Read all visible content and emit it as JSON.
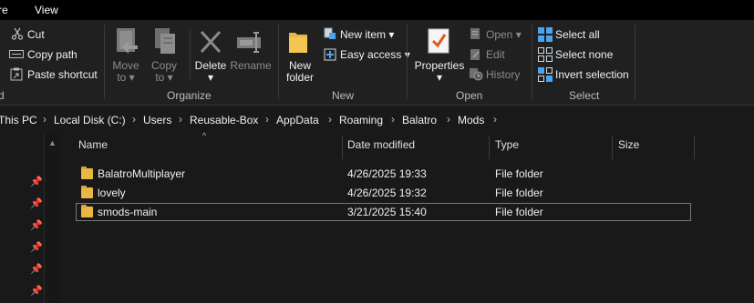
{
  "menubar": {
    "tabs": [
      "re",
      "View"
    ]
  },
  "ribbon": {
    "clipboard": {
      "cut": "Cut",
      "copy_path": "Copy path",
      "paste_shortcut": "Paste shortcut",
      "label": "d"
    },
    "organize": {
      "move_to": [
        "Move",
        "to"
      ],
      "copy_to": [
        "Copy",
        "to"
      ],
      "delete": "Delete",
      "rename": "Rename",
      "label": "Organize"
    },
    "new": {
      "new_folder": [
        "New",
        "folder"
      ],
      "new_item": "New item",
      "easy_access": "Easy access",
      "label": "New"
    },
    "open": {
      "properties": "Properties",
      "open": "Open",
      "edit": "Edit",
      "history": "History",
      "label": "Open"
    },
    "select": {
      "select_all": "Select all",
      "select_none": "Select none",
      "invert_selection": "Invert selection",
      "label": "Select"
    }
  },
  "address": {
    "crumbs": [
      "This PC",
      "Local Disk (C:)",
      "Users",
      "Reusable-Box",
      "AppData",
      "Roaming",
      "Balatro",
      "Mods"
    ],
    "separator": "›"
  },
  "columns": {
    "name": "Name",
    "date": "Date modified",
    "type": "Type",
    "size": "Size"
  },
  "files": [
    {
      "name": "BalatroMultiplayer",
      "date": "4/26/2025 19:33",
      "type": "File folder",
      "size": ""
    },
    {
      "name": "lovely",
      "date": "4/26/2025 19:32",
      "type": "File folder",
      "size": ""
    },
    {
      "name": "smods-main",
      "date": "3/21/2025 15:40",
      "type": "File folder",
      "size": ""
    }
  ],
  "colors": {
    "folder": "#e8b744",
    "accent": "#4aa3f0",
    "background": "#191919"
  }
}
